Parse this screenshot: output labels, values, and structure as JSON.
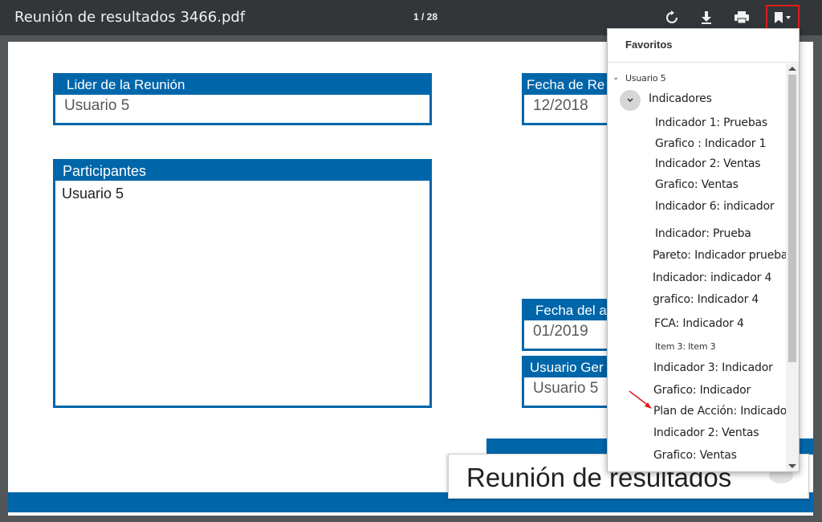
{
  "toolbar": {
    "title": "Reunión de resultados 3466.pdf",
    "page_counter": "1 / 28",
    "icons": [
      "rotate-icon",
      "download-icon",
      "print-icon",
      "bookmark-icon"
    ]
  },
  "page": {
    "leader": {
      "label": "Lider de la Reunión",
      "value": "Usuario 5"
    },
    "meeting_date": {
      "label": "Fecha de Re",
      "value": "12/2018"
    },
    "participants": {
      "label": "Participantes",
      "value": "Usuario 5"
    },
    "period_date": {
      "label": "Fecha del a",
      "value": "01/2019"
    },
    "general_user": {
      "label": "Usuario Ger",
      "value": "Usuario 5"
    },
    "title_block": "Reunión de resultados"
  },
  "bookmarks": {
    "header": "Favoritos",
    "root": "Usuario 5",
    "group": "Indicadores",
    "items": [
      "Indicador 1: Pruebas",
      "Grafico : Indicador 1",
      "Indicador 2: Ventas",
      "Grafico: Ventas",
      "Indicador 6: indicador",
      "Indicador: Prueba",
      "Pareto: Indicador prueba",
      "Indicador: indicador 4",
      "grafico: Indicador 4",
      "FCA: Indicador 4",
      "Item 3: Item 3",
      "Indicador 3: Indicador",
      "Grafico: Indicador",
      "Plan de Acción: Indicador",
      "Indicador 2: Ventas",
      "Grafico: Ventas"
    ]
  },
  "colors": {
    "accent": "#0066aa",
    "toolbar": "#323639",
    "highlight": "#e01b1b"
  }
}
